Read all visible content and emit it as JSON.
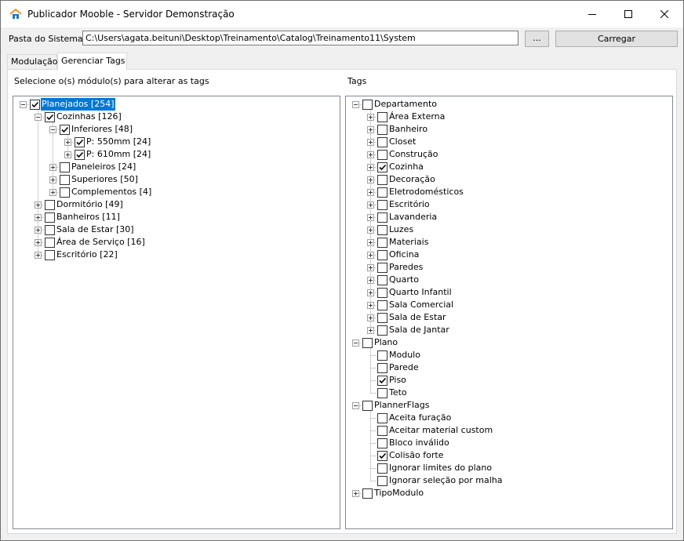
{
  "window": {
    "title": "Publicador Mooble - Servidor Demonstração",
    "minimize_label": "minimize",
    "maximize_label": "maximize",
    "close_label": "close"
  },
  "toolbar": {
    "path_label": "Pasta do Sistema:",
    "path_value": "C:\\Users\\agata.beituni\\Desktop\\Treinamento\\Catalog\\Treinamento11\\System",
    "browse_label": "...",
    "load_label": "Carregar"
  },
  "tabs": [
    {
      "label": "Modulação",
      "active": false
    },
    {
      "label": "Gerenciar Tags",
      "active": true
    }
  ],
  "left_panel": {
    "label": "Selecione o(s) módulo(s) para alterar as tags",
    "nodes": [
      {
        "label": "Planejados [254]",
        "level": 0,
        "expander": "minus",
        "checked": true,
        "selected": true
      },
      {
        "label": "Cozinhas [126]",
        "level": 1,
        "expander": "minus",
        "checked": true
      },
      {
        "label": "Inferiores [48]",
        "level": 2,
        "expander": "minus",
        "checked": true
      },
      {
        "label": "P: 550mm [24]",
        "level": 3,
        "expander": "plus",
        "checked": true
      },
      {
        "label": "P: 610mm [24]",
        "level": 3,
        "expander": "plus",
        "checked": true
      },
      {
        "label": "Paneleiros [24]",
        "level": 2,
        "expander": "plus",
        "checked": false
      },
      {
        "label": "Superiores [50]",
        "level": 2,
        "expander": "plus",
        "checked": false
      },
      {
        "label": "Complementos [4]",
        "level": 2,
        "expander": "plus",
        "checked": false
      },
      {
        "label": "Dormitório [49]",
        "level": 1,
        "expander": "plus",
        "checked": false
      },
      {
        "label": "Banheiros [11]",
        "level": 1,
        "expander": "plus",
        "checked": false
      },
      {
        "label": "Sala de Estar [30]",
        "level": 1,
        "expander": "plus",
        "checked": false
      },
      {
        "label": "Área de Serviço [16]",
        "level": 1,
        "expander": "plus",
        "checked": false
      },
      {
        "label": "Escritório [22]",
        "level": 1,
        "expander": "plus",
        "checked": false
      }
    ]
  },
  "right_panel": {
    "label": "Tags",
    "nodes": [
      {
        "label": "Departamento",
        "level": 0,
        "expander": "minus",
        "checked": false
      },
      {
        "label": "Área Externa",
        "level": 1,
        "expander": "plus",
        "checked": false
      },
      {
        "label": "Banheiro",
        "level": 1,
        "expander": "plus",
        "checked": false
      },
      {
        "label": "Closet",
        "level": 1,
        "expander": "plus",
        "checked": false
      },
      {
        "label": "Construção",
        "level": 1,
        "expander": "plus",
        "checked": false
      },
      {
        "label": "Cozinha",
        "level": 1,
        "expander": "plus",
        "checked": true
      },
      {
        "label": "Decoração",
        "level": 1,
        "expander": "plus",
        "checked": false
      },
      {
        "label": "Eletrodomésticos",
        "level": 1,
        "expander": "plus",
        "checked": false
      },
      {
        "label": "Escritório",
        "level": 1,
        "expander": "plus",
        "checked": false
      },
      {
        "label": "Lavanderia",
        "level": 1,
        "expander": "plus",
        "checked": false
      },
      {
        "label": "Luzes",
        "level": 1,
        "expander": "plus",
        "checked": false
      },
      {
        "label": "Materiais",
        "level": 1,
        "expander": "plus",
        "checked": false
      },
      {
        "label": "Oficina",
        "level": 1,
        "expander": "plus",
        "checked": false
      },
      {
        "label": "Paredes",
        "level": 1,
        "expander": "plus",
        "checked": false
      },
      {
        "label": "Quarto",
        "level": 1,
        "expander": "plus",
        "checked": false
      },
      {
        "label": "Quarto Infantil",
        "level": 1,
        "expander": "plus",
        "checked": false
      },
      {
        "label": "Sala Comercial",
        "level": 1,
        "expander": "plus",
        "checked": false
      },
      {
        "label": "Sala de Estar",
        "level": 1,
        "expander": "plus",
        "checked": false
      },
      {
        "label": "Sala de Jantar",
        "level": 1,
        "expander": "plus",
        "checked": false
      },
      {
        "label": "Plano",
        "level": 0,
        "expander": "minus",
        "checked": false
      },
      {
        "label": "Modulo",
        "level": 1,
        "expander": "none",
        "checked": false
      },
      {
        "label": "Parede",
        "level": 1,
        "expander": "none",
        "checked": false
      },
      {
        "label": "Piso",
        "level": 1,
        "expander": "none",
        "checked": true
      },
      {
        "label": "Teto",
        "level": 1,
        "expander": "none",
        "checked": false
      },
      {
        "label": "PlannerFlags",
        "level": 0,
        "expander": "minus",
        "checked": false
      },
      {
        "label": "Aceita furação",
        "level": 1,
        "expander": "none",
        "checked": false
      },
      {
        "label": "Aceitar material custom",
        "level": 1,
        "expander": "none",
        "checked": false
      },
      {
        "label": "Bloco inválido",
        "level": 1,
        "expander": "none",
        "checked": false
      },
      {
        "label": "Colisão forte",
        "level": 1,
        "expander": "none",
        "checked": true
      },
      {
        "label": "Ignorar limites do plano",
        "level": 1,
        "expander": "none",
        "checked": false
      },
      {
        "label": "Ignorar seleção por malha",
        "level": 1,
        "expander": "none",
        "checked": false
      },
      {
        "label": "TipoModulo",
        "level": 0,
        "expander": "plus",
        "checked": false
      }
    ]
  },
  "colors": {
    "selection": "#0078d7",
    "app_icon_roof": "#f29d38",
    "app_icon_house": "#1e74c8"
  }
}
